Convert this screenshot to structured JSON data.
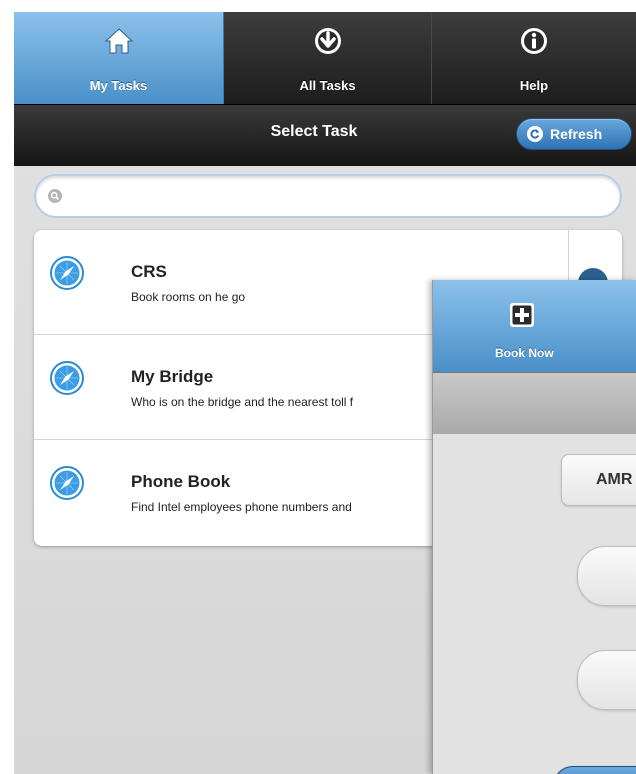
{
  "tabs": [
    {
      "label": "My Tasks",
      "icon": "home-icon",
      "active": true
    },
    {
      "label": "All Tasks",
      "icon": "download-circle-icon",
      "active": false
    },
    {
      "label": "Help",
      "icon": "info-icon",
      "active": false
    }
  ],
  "header": {
    "title": "Select Task",
    "refresh_label": "Refresh",
    "refresh_icon": "refresh-icon"
  },
  "search": {
    "placeholder": "",
    "value": "",
    "icon": "search-icon"
  },
  "tasks": [
    {
      "name": "CRS",
      "description": "Book rooms on he go",
      "icon": "compass-icon"
    },
    {
      "name": "My Bridge",
      "description": "Who is on the bridge and the nearest toll f",
      "icon": "compass-icon"
    },
    {
      "name": "Phone Book",
      "description": "Find Intel employees phone numbers and",
      "icon": "compass-icon"
    }
  ],
  "overlay": {
    "tab_label": "Book Now",
    "tab_icon": "plus-square-icon",
    "field_label": "AMR"
  },
  "colors": {
    "accent_blue": "#4a90c9",
    "dark_bar": "#1d1d1d",
    "list_bg": "#ffffff",
    "page_bg": "#d6d6d6"
  }
}
